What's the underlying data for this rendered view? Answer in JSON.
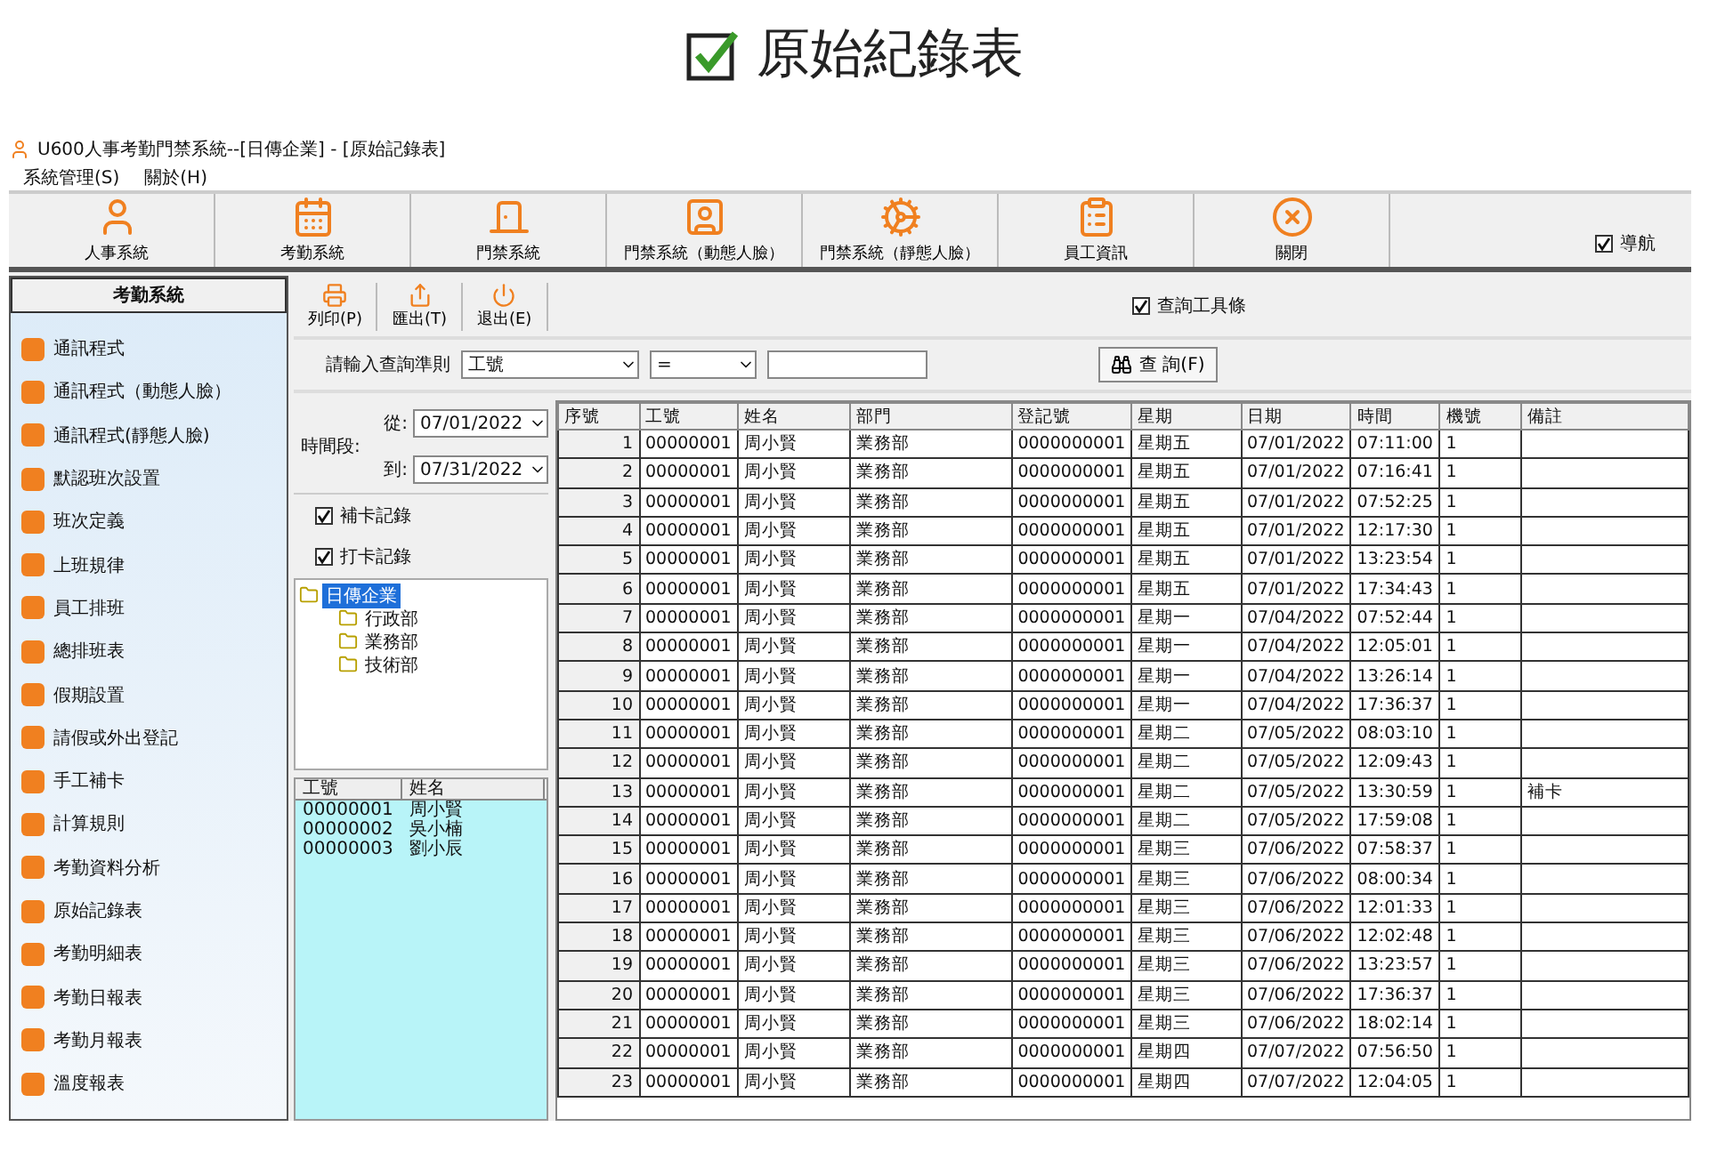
{
  "heading": {
    "title": "原始紀錄表",
    "checked": true
  },
  "window": {
    "title": "U600人事考勤門禁系統--[日傳企業] - [原始記錄表]"
  },
  "menu": [
    "系統管理(S)",
    "關於(H)"
  ],
  "toolbar": [
    {
      "label": "人事系統"
    },
    {
      "label": "考勤系統"
    },
    {
      "label": "門禁系統"
    },
    {
      "label": "門禁系統（動態人臉）"
    },
    {
      "label": "門禁系統（靜態人臉）"
    },
    {
      "label": "員工資訊"
    },
    {
      "label": "關閉"
    }
  ],
  "nav_toggle": {
    "label": "導航",
    "checked": true
  },
  "sidebar": {
    "title": "考勤系統",
    "items": [
      "通訊程式",
      "通訊程式（動態人臉）",
      "通訊程式(靜態人臉)",
      "默認班次設置",
      "班次定義",
      "上班規律",
      "員工排班",
      "總排班表",
      "假期設置",
      "請假或外出登記",
      "手工補卡",
      "計算規則",
      "考勤資料分析",
      "原始記錄表",
      "考勤明細表",
      "考勤日報表",
      "考勤月報表",
      "溫度報表"
    ]
  },
  "actions": [
    "列印(P)",
    "匯出(T)",
    "退出(E)"
  ],
  "query_toolbar": {
    "label": "查詢工具條",
    "checked": true
  },
  "query": {
    "label": "請輸入查詢準則",
    "field": "工號",
    "operator": "=",
    "button": "查 詢(F)"
  },
  "period": {
    "label": "時間段:",
    "from_label": "從:",
    "from": "07/01/2022",
    "to_label": "到:",
    "to": "07/31/2022"
  },
  "filters": [
    {
      "label": "補卡記錄",
      "checked": true
    },
    {
      "label": "打卡記錄",
      "checked": true
    }
  ],
  "tree": {
    "label": "日傳企業",
    "selected": true,
    "children": [
      {
        "label": "行政部",
        "selected": false
      },
      {
        "label": "業務部",
        "selected": false
      },
      {
        "label": "技術部",
        "selected": false
      }
    ]
  },
  "employees": {
    "columns": [
      "工號",
      "姓名"
    ],
    "rows": [
      [
        "00000001",
        "周小賢"
      ],
      [
        "00000002",
        "吳小楠"
      ],
      [
        "00000003",
        "劉小辰"
      ]
    ]
  },
  "table": {
    "columns": [
      "序號",
      "工號",
      "姓名",
      "部門",
      "登記號",
      "星期",
      "日期",
      "時間",
      "機號",
      "備註"
    ],
    "rows": [
      [
        "1",
        "00000001",
        "周小賢",
        "業務部",
        "0000000001",
        "星期五",
        "07/01/2022",
        "07:11:00",
        "1",
        ""
      ],
      [
        "2",
        "00000001",
        "周小賢",
        "業務部",
        "0000000001",
        "星期五",
        "07/01/2022",
        "07:16:41",
        "1",
        ""
      ],
      [
        "3",
        "00000001",
        "周小賢",
        "業務部",
        "0000000001",
        "星期五",
        "07/01/2022",
        "07:52:25",
        "1",
        ""
      ],
      [
        "4",
        "00000001",
        "周小賢",
        "業務部",
        "0000000001",
        "星期五",
        "07/01/2022",
        "12:17:30",
        "1",
        ""
      ],
      [
        "5",
        "00000001",
        "周小賢",
        "業務部",
        "0000000001",
        "星期五",
        "07/01/2022",
        "13:23:54",
        "1",
        ""
      ],
      [
        "6",
        "00000001",
        "周小賢",
        "業務部",
        "0000000001",
        "星期五",
        "07/01/2022",
        "17:34:43",
        "1",
        ""
      ],
      [
        "7",
        "00000001",
        "周小賢",
        "業務部",
        "0000000001",
        "星期一",
        "07/04/2022",
        "07:52:44",
        "1",
        ""
      ],
      [
        "8",
        "00000001",
        "周小賢",
        "業務部",
        "0000000001",
        "星期一",
        "07/04/2022",
        "12:05:01",
        "1",
        ""
      ],
      [
        "9",
        "00000001",
        "周小賢",
        "業務部",
        "0000000001",
        "星期一",
        "07/04/2022",
        "13:26:14",
        "1",
        ""
      ],
      [
        "10",
        "00000001",
        "周小賢",
        "業務部",
        "0000000001",
        "星期一",
        "07/04/2022",
        "17:36:37",
        "1",
        ""
      ],
      [
        "11",
        "00000001",
        "周小賢",
        "業務部",
        "0000000001",
        "星期二",
        "07/05/2022",
        "08:03:10",
        "1",
        ""
      ],
      [
        "12",
        "00000001",
        "周小賢",
        "業務部",
        "0000000001",
        "星期二",
        "07/05/2022",
        "12:09:43",
        "1",
        ""
      ],
      [
        "13",
        "00000001",
        "周小賢",
        "業務部",
        "0000000001",
        "星期二",
        "07/05/2022",
        "13:30:59",
        "1",
        "補卡"
      ],
      [
        "14",
        "00000001",
        "周小賢",
        "業務部",
        "0000000001",
        "星期二",
        "07/05/2022",
        "17:59:08",
        "1",
        ""
      ],
      [
        "15",
        "00000001",
        "周小賢",
        "業務部",
        "0000000001",
        "星期三",
        "07/06/2022",
        "07:58:37",
        "1",
        ""
      ],
      [
        "16",
        "00000001",
        "周小賢",
        "業務部",
        "0000000001",
        "星期三",
        "07/06/2022",
        "08:00:34",
        "1",
        ""
      ],
      [
        "17",
        "00000001",
        "周小賢",
        "業務部",
        "0000000001",
        "星期三",
        "07/06/2022",
        "12:01:33",
        "1",
        ""
      ],
      [
        "18",
        "00000001",
        "周小賢",
        "業務部",
        "0000000001",
        "星期三",
        "07/06/2022",
        "12:02:48",
        "1",
        ""
      ],
      [
        "19",
        "00000001",
        "周小賢",
        "業務部",
        "0000000001",
        "星期三",
        "07/06/2022",
        "13:23:57",
        "1",
        ""
      ],
      [
        "20",
        "00000001",
        "周小賢",
        "業務部",
        "0000000001",
        "星期三",
        "07/06/2022",
        "17:36:37",
        "1",
        ""
      ],
      [
        "21",
        "00000001",
        "周小賢",
        "業務部",
        "0000000001",
        "星期三",
        "07/06/2022",
        "18:02:14",
        "1",
        ""
      ],
      [
        "22",
        "00000001",
        "周小賢",
        "業務部",
        "0000000001",
        "星期四",
        "07/07/2022",
        "07:56:50",
        "1",
        ""
      ],
      [
        "23",
        "00000001",
        "周小賢",
        "業務部",
        "0000000001",
        "星期四",
        "07/07/2022",
        "12:04:05",
        "1",
        ""
      ]
    ]
  }
}
